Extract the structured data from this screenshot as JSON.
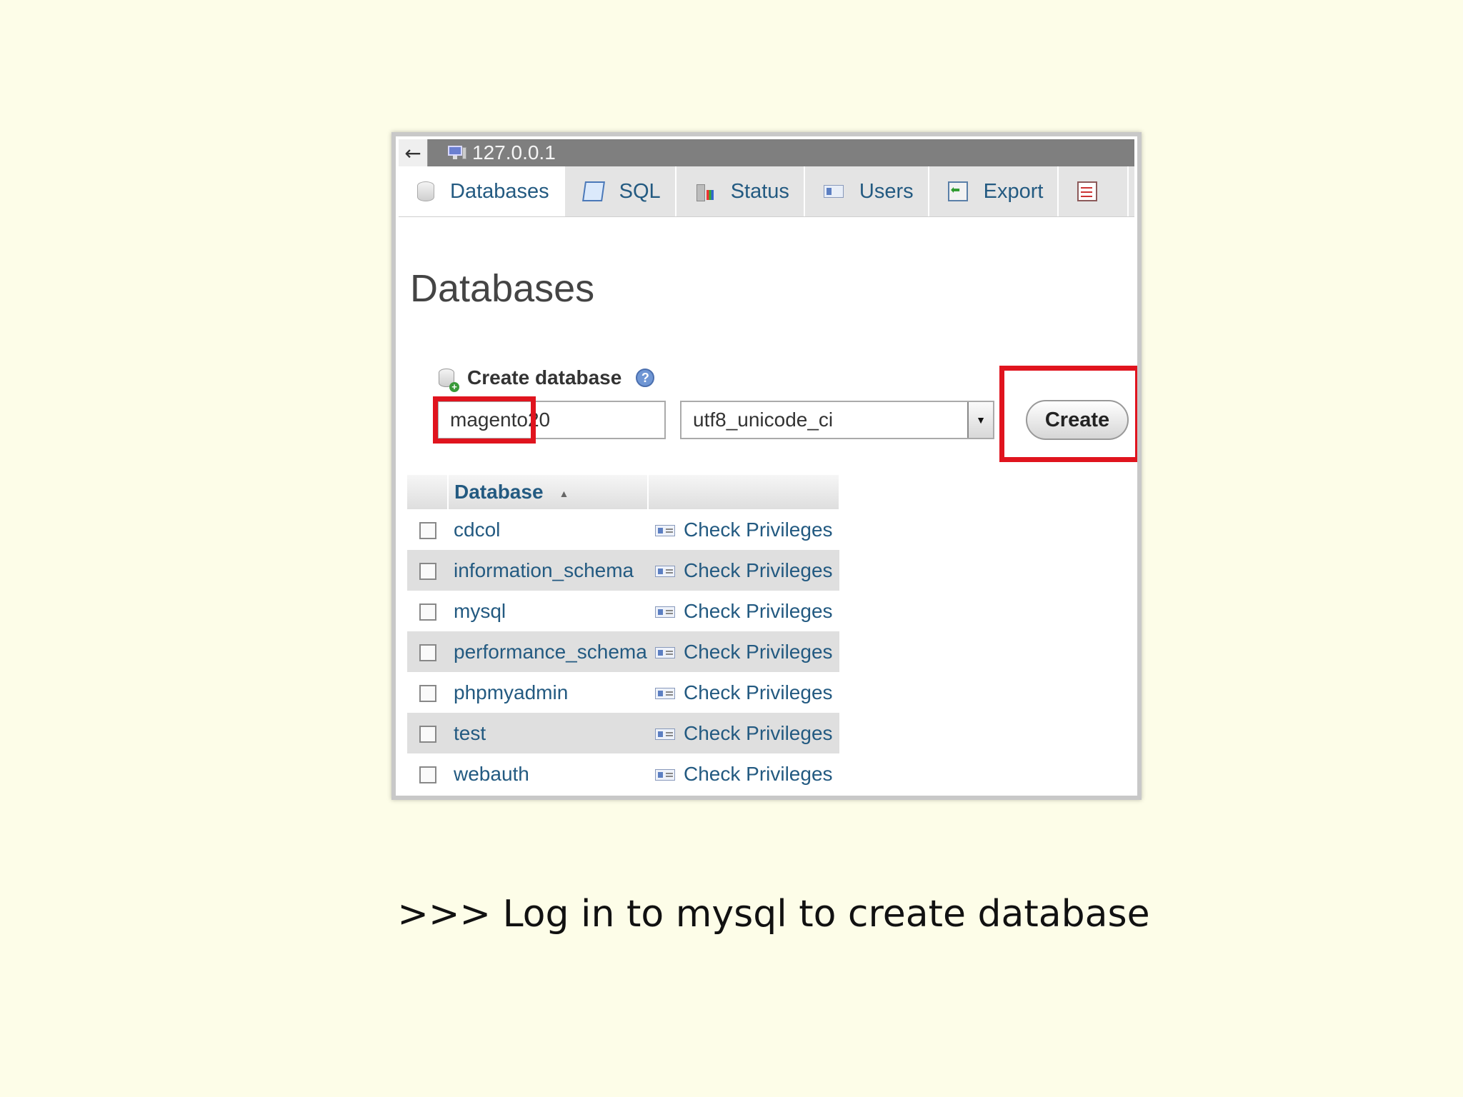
{
  "window": {
    "server": "127.0.0.1"
  },
  "tabs": [
    {
      "label": "Databases",
      "icon": "database-icon"
    },
    {
      "label": "SQL",
      "icon": "sql-icon"
    },
    {
      "label": "Status",
      "icon": "status-icon"
    },
    {
      "label": "Users",
      "icon": "users-icon"
    },
    {
      "label": "Export",
      "icon": "export-icon"
    },
    {
      "label": "",
      "icon": "more-icon"
    }
  ],
  "page": {
    "title": "Databases"
  },
  "create": {
    "label": "Create database",
    "name_value": "magento20",
    "collation": "utf8_unicode_ci",
    "button": "Create"
  },
  "table": {
    "header": "Database",
    "rows": [
      {
        "name": "cdcol",
        "action": "Check Privileges"
      },
      {
        "name": "information_schema",
        "action": "Check Privileges"
      },
      {
        "name": "mysql",
        "action": "Check Privileges"
      },
      {
        "name": "performance_schema",
        "action": "Check Privileges"
      },
      {
        "name": "phpmyadmin",
        "action": "Check Privileges"
      },
      {
        "name": "test",
        "action": "Check Privileges"
      },
      {
        "name": "webauth",
        "action": "Check Privileges"
      }
    ]
  },
  "caption": ">>> Log in to mysql to create database",
  "colors": {
    "background": "#fdfde8",
    "highlight": "#e0141e",
    "link": "#235a81"
  }
}
